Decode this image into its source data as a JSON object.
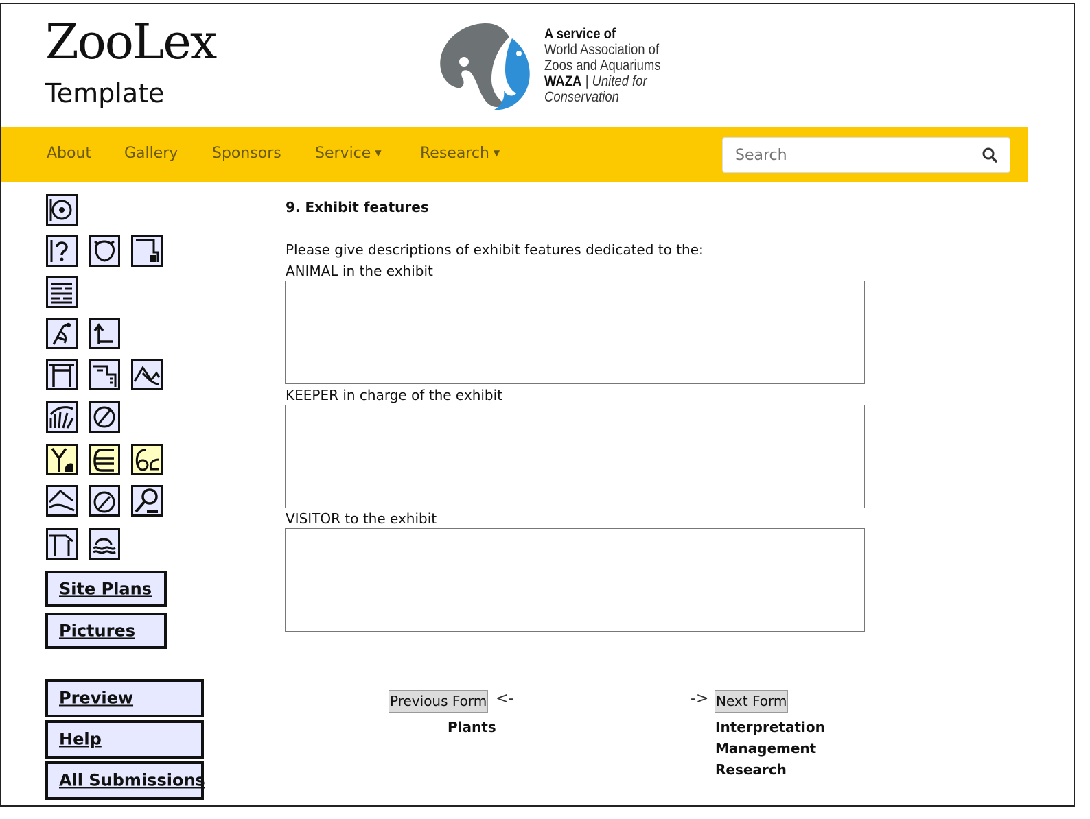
{
  "brand": {
    "logo_text": "ZooLex",
    "subtitle": "Template"
  },
  "waza": {
    "line1": "A service of",
    "line2": "World Association of",
    "line3": "Zoos and Aquariums",
    "line4_bold": "WAZA",
    "line4_rest": " | United for",
    "line5": "Conservation"
  },
  "navbar": {
    "items": [
      {
        "label": "About"
      },
      {
        "label": "Gallery"
      },
      {
        "label": "Sponsors"
      },
      {
        "label": "Service"
      },
      {
        "label": "Research"
      }
    ],
    "search_placeholder": "Search"
  },
  "sidebar": {
    "site_plans": "Site Plans",
    "pictures": "Pictures",
    "preview": "Preview",
    "help": "Help",
    "all_submissions": "All Submissions"
  },
  "main": {
    "section_title": "9. Exhibit features",
    "intro": "Please give descriptions of exhibit features dedicated to the:",
    "fields": [
      {
        "label": "ANIMAL in the exhibit",
        "value": ""
      },
      {
        "label": "KEEPER in charge of the exhibit",
        "value": ""
      },
      {
        "label": "VISITOR to the exhibit",
        "value": ""
      }
    ]
  },
  "pager": {
    "previous_label": "Previous Form",
    "previous_arrow": "<-",
    "previous_links": [
      "Plants"
    ],
    "next_label": "Next Form",
    "next_arrow": "->",
    "next_links": [
      "Interpretation",
      "Management",
      "Research"
    ]
  },
  "colors": {
    "navbar": "#fcc800",
    "tile_blue": "#e6e9ff",
    "tile_yellow": "#ffffc2",
    "waza_blue": "#2e8ed6",
    "waza_gray": "#6d7275"
  }
}
